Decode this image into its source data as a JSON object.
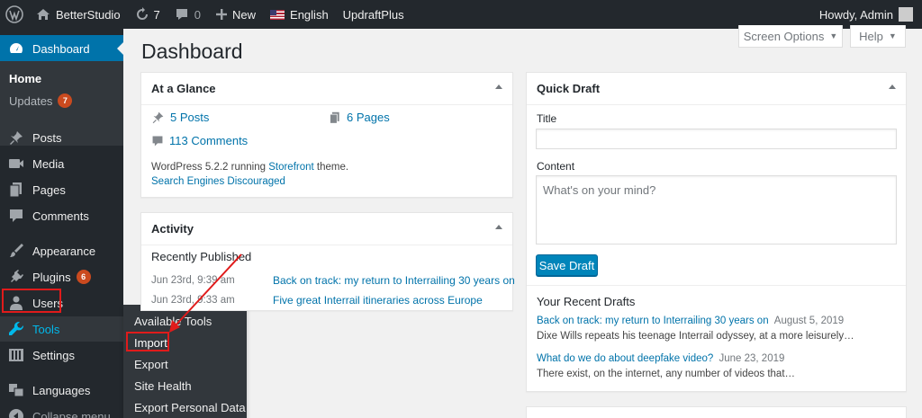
{
  "adminbar": {
    "site_name": "BetterStudio",
    "updates_count": "7",
    "comments_count": "0",
    "new_label": "New",
    "language_label": "English",
    "plugin_label": "UpdraftPlus",
    "greeting": "Howdy, Admin"
  },
  "sidebar": {
    "dashboard": "Dashboard",
    "home": "Home",
    "updates": "Updates",
    "updates_badge": "7",
    "posts": "Posts",
    "media": "Media",
    "pages": "Pages",
    "comments": "Comments",
    "appearance": "Appearance",
    "plugins": "Plugins",
    "plugins_badge": "6",
    "users": "Users",
    "tools": "Tools",
    "settings": "Settings",
    "languages": "Languages",
    "collapse": "Collapse menu"
  },
  "tools_flyout": {
    "available_tools": "Available Tools",
    "import": "Import",
    "export": "Export",
    "site_health": "Site Health",
    "export_personal": "Export Personal Data"
  },
  "header": {
    "title": "Dashboard",
    "screen_options": "Screen Options",
    "help": "Help"
  },
  "at_a_glance": {
    "title": "At a Glance",
    "posts": "5 Posts",
    "pages": "6 Pages",
    "comments": "113 Comments",
    "version_prefix": "WordPress 5.2.2 running ",
    "theme": "Storefront",
    "version_suffix": " theme.",
    "search_engines": "Search Engines Discouraged"
  },
  "activity": {
    "title": "Activity",
    "recently_published": "Recently Published",
    "items": [
      {
        "date": "Jun 23rd, 9:39 am",
        "title": "Back on track: my return to Interrailing 30 years on"
      },
      {
        "date": "Jun 23rd, 9:33 am",
        "title": "Five great Interrail itineraries across Europe"
      }
    ]
  },
  "quick_draft": {
    "title": "Quick Draft",
    "title_label": "Title",
    "content_label": "Content",
    "content_placeholder": "What's on your mind?",
    "save_button": "Save Draft",
    "recent_drafts_heading": "Your Recent Drafts",
    "drafts": [
      {
        "title": "Back on track: my return to Interrailing 30 years on",
        "date": "August 5, 2019",
        "excerpt": "Dixe Wills repeats his teenage Interrail odyssey, at a more leisurely…"
      },
      {
        "title": "What do we do about deepfake video?",
        "date": "June 23, 2019",
        "excerpt": "There exist, on the internet, any number of videos that…"
      }
    ]
  },
  "colors": {
    "adminbar_bg": "#23282d",
    "menu_bg": "#23282d",
    "submenu_bg": "#32373c",
    "current_menu": "#0073aa",
    "link": "#0073aa",
    "badge": "#ca4a1f",
    "annotation_red": "#e01b1b"
  }
}
